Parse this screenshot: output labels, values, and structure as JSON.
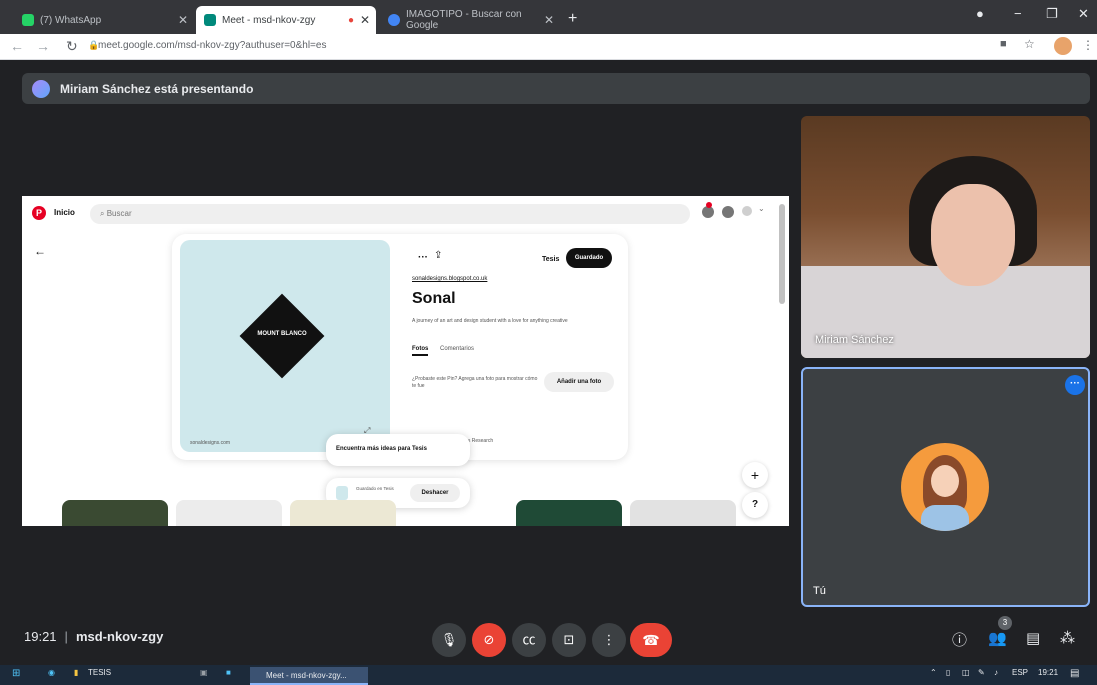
{
  "browser": {
    "tabs": [
      {
        "label": "(7) WhatsApp",
        "favicon_color": "#25d366"
      },
      {
        "label": "Meet - msd-nkov-zgy",
        "favicon_color": "#00897b"
      },
      {
        "label": "IMAGOTIPO - Buscar con Google",
        "favicon_color": "#4285f4"
      }
    ],
    "new_tab": "+",
    "url": "meet.google.com/msd-nkov-zgy?authuser=0&hl=es",
    "window_controls": [
      "−",
      "❐",
      "✕"
    ]
  },
  "meet": {
    "presenting_banner": "Miriam Sánchez está presentando",
    "participants": [
      {
        "name": "Miriam Sánchez"
      },
      {
        "name": "Tú"
      }
    ],
    "time": "19:21",
    "meeting_code": "msd-nkov-zgy",
    "people_count": "3"
  },
  "shared_screen": {
    "nav_home": "Inicio",
    "search_placeholder": "Buscar",
    "board_name": "Tesis",
    "save_button": "Guardado",
    "link": "sonaldesigns.blogspot.co.uk",
    "title": "Sonal",
    "description": "A journey of an art and design student with a love for anything creative",
    "tab_photos": "Fotos",
    "tab_comments": "Comentarios",
    "tried_text": "¿Probaste este Pin? Agrega una foto para mostrar cómo te fue",
    "add_photo_button": "Añadir una foto",
    "saved_in": "Lo has guardado en Class Research",
    "logo_text": "MOUNT BLANCO",
    "source_domain": "sonaldesigns.com",
    "popup_text": "Encuentra más ideas para Tesis",
    "toast_text": "Guardado en Tesis",
    "undo_button": "Deshacer",
    "plus_button": "+",
    "help_button": "?"
  },
  "taskbar": {
    "folder_label": "TESIS",
    "meet_item": "Meet - msd-nkov-zgy...",
    "lang": "ESP",
    "time": "19:21"
  },
  "colors": {
    "meet_bg": "#202124",
    "end_call": "#ea4335",
    "accent_blue": "#8ab4f8",
    "pinterest_red": "#e60023"
  }
}
